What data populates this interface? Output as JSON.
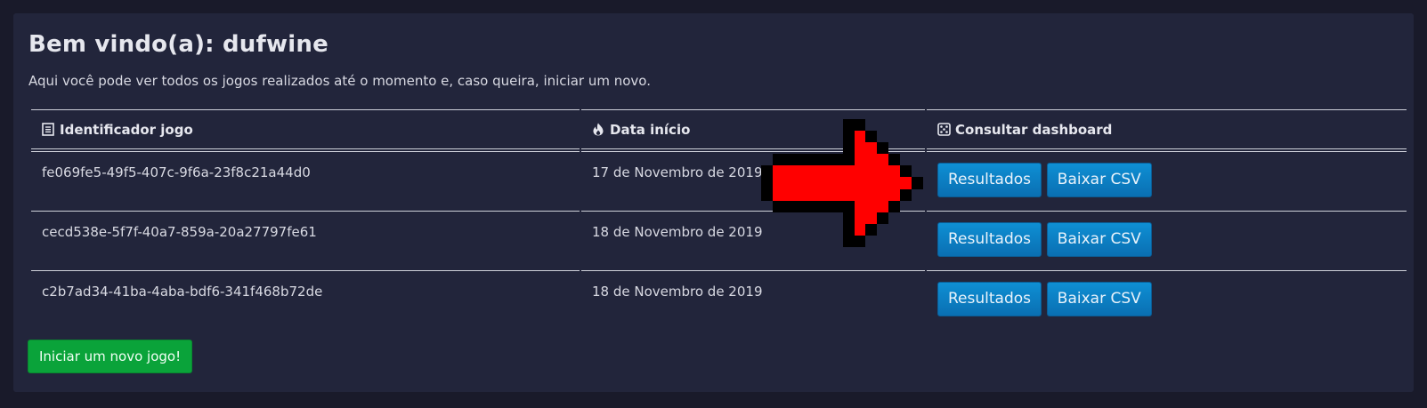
{
  "header": {
    "welcome": "Bem vindo(a): dufwine",
    "subtitle": "Aqui você pode ver todos os jogos realizados até o momento e, caso queira, iniciar um novo."
  },
  "table": {
    "columns": [
      {
        "label": "Identificador jogo",
        "icon": "list-icon"
      },
      {
        "label": "Data início",
        "icon": "fire-icon"
      },
      {
        "label": "Consultar dashboard",
        "icon": "dice-icon"
      }
    ],
    "rows": [
      {
        "id": "fe069fe5-49f5-407c-9f6a-23f8c21a44d0",
        "date": "17 de Novembro de 2019",
        "results_label": "Resultados",
        "csv_label": "Baixar CSV"
      },
      {
        "id": "cecd538e-5f7f-40a7-859a-20a27797fe61",
        "date": "18 de Novembro de 2019",
        "results_label": "Resultados",
        "csv_label": "Baixar CSV"
      },
      {
        "id": "c2b7ad34-41ba-4aba-bdf6-341f468b72de",
        "date": "18 de Novembro de 2019",
        "results_label": "Resultados",
        "csv_label": "Baixar CSV"
      }
    ]
  },
  "new_game_label": "Iniciar um novo jogo!",
  "colors": {
    "page_bg": "#191a2a",
    "card_bg": "#22253b",
    "button_blue": "#0a7bc2",
    "button_green": "#0aa33a",
    "arrow": "#ff0000"
  }
}
